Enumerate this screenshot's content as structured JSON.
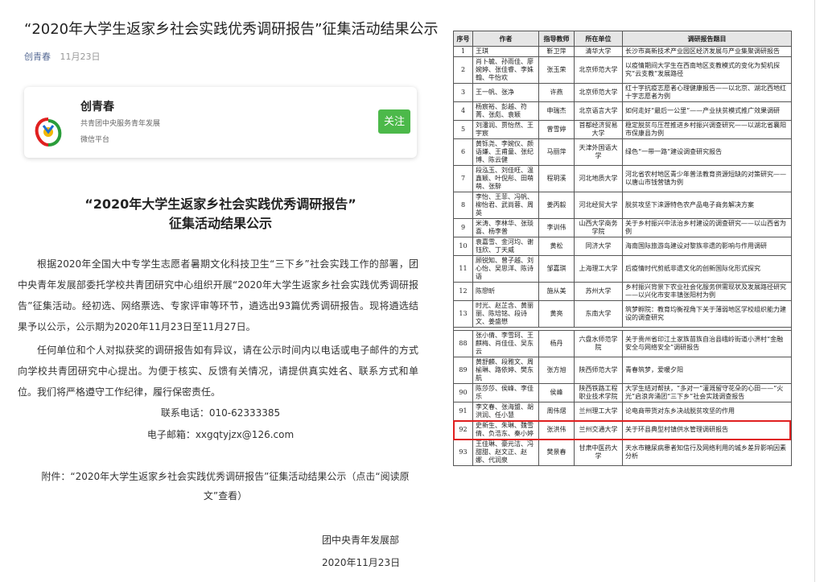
{
  "article": {
    "title": "“2020年大学生返家乡社会实践优秀调研报告”征集活动结果公示",
    "author": "创青春",
    "date": "11月23日"
  },
  "account_card": {
    "name": "创青春",
    "org": "共青团中央服务青年发展",
    "type": "微信平台",
    "follow_label": "关注",
    "follow_color": "#4cb94a"
  },
  "body": {
    "heading_line1": "“2020年大学生返家乡社会实践优秀调研报告”",
    "heading_line2": "征集活动结果公示",
    "para1": "根据2020年全国大中专学生志愿者暑期文化科技卫生“三下乡”社会实践工作的部署，团中央青年发展部委托学校共青团研究中心组织开展“2020年大学生返家乡社会实践优秀调研报告”征集活动。经初选、网络票选、专家评审等环节，遴选出93篇优秀调研报告。现将遴选结果予以公示，公示期为2020年11月23日至11月27日。",
    "para2": "任何单位和个人对拟获奖的调研报告如有异议，请在公示时间内以电话或电子邮件的方式向学校共青团研究中心提出。为便于核实、反馈有关情况，请提供真实姓名、联系方式和单位。我们将严格遵守工作纪律，履行保密责任。",
    "phone": "联系电话：010-62333385",
    "email": "电子邮箱：xxgqtyjzx@126.com",
    "attachment": "附件：“2020年大学生返家乡社会实践优秀调研报告”征集活动结果公示（点击“阅读原文”查看）",
    "signature": "团中央青年发展部",
    "sign_date": "2020年11月23日"
  },
  "table": {
    "headers": [
      "序号",
      "作者",
      "指导教师",
      "所在单位",
      "调研报告题目"
    ],
    "rows_top": [
      [
        "1",
        "王琪",
        "靳卫萍",
        "清华大学",
        "长沙市高新技术产业园区经济发展与产业集聚调研报告"
      ],
      [
        "2",
        "肖卜毓、孙雨佳、廖婉婷、张佳睿、李姝翰、牛怡欢",
        "张玉荣",
        "北京师范大学",
        "以疫情期间大学生在西南地区支教模式的变化为契机探究“云支教”发展路径"
      ],
      [
        "3",
        "王一帆、张净",
        "许燕",
        "北京师范大学",
        "红十字抗疫志愿者心理健康报告——以北京、湖北西地红十字志愿者为例"
      ],
      [
        "4",
        "杨宸裕、彭越、符菁、张彪、袁颖",
        "申瑞杰",
        "北京语言大学",
        "如何走好“最后一公里”——产业扶贫模式推广效果调研"
      ],
      [
        "5",
        "刘潘润、贾怡然、王宇宸",
        "曾雪婷",
        "首都经济贸易大学",
        "稳定脱贫与压茬推进乡村振兴调查研究——以湖北省襄阳市保康县为例"
      ],
      [
        "6",
        "黄铄尧、李婉仪、颜语嫌、王甫童、张纪博、陈云健",
        "马丽萍",
        "天津外国语大学",
        "绿色“一带一路”建设调查研究报告"
      ],
      [
        "7",
        "段泓玉、刘佳旺、温鑫颖、叶倪彤、田萌萌、张騂",
        "程玥溪",
        "河北地质大学",
        "河北省农村地区青少年普法教育资源短缺的对策研究——以唐山市钱营镇为例"
      ],
      [
        "8",
        "李怡、王菲、冯帆、柳怡君、武尚蓉、周英",
        "姜丙毅",
        "河北经贸大学",
        "脱贫攻坚下涞源特色农产品电子商务解决方案"
      ],
      [
        "9",
        "米涛、李林华、张琰喜、杨李普",
        "李训伟",
        "山西大学商务学院",
        "关于乡村振兴中法治乡村建设的调查研究——以山西省为例"
      ],
      [
        "10",
        "袁嘉雪、金河均、谢钰欣、丁天威",
        "黄松",
        "同济大学",
        "海南国际旅游岛建设对黎族非遗的影响与作用调研"
      ],
      [
        "11",
        "顾锐知、曾子越、刘心怡、吴思洋、陈诗语",
        "邹嘉琪",
        "上海理工大学",
        "后疫情时代剪纸非遗文化的创新国际化形式探究"
      ],
      [
        "12",
        "陈戀昕",
        "施从美",
        "苏州大学",
        "乡村振兴背景下农业社会化服务供需现状及发展路径研究——以兴化市安丰镇张阳村为例"
      ],
      [
        "13",
        "时光、赵芷含、黄丽丽、陈培铭、段诗文、姜盛懋",
        "黄亮",
        "东南大学",
        "筑梦孵院：教育均衡视角下关于薄弱地区学校组织能力建设的调查研究"
      ]
    ],
    "rows_bottom": [
      [
        "88",
        "张小倩、李雪珂、王麒梅、肖佳佳、吴东云",
        "杨丹",
        "六盘水师范学院",
        "关于贵州省印江土家族苗族自治县峨岭街道小淠村“金融安全与网络安全”调研报告"
      ],
      [
        "89",
        "黄舒麟、段雅文、周榆琳、路依婷、樊东航",
        "张方旭",
        "陕西师范大学",
        "青春筑梦，爱暖夕阳"
      ],
      [
        "90",
        "陈莎莎、侯峰、李佳乐",
        "侯峰",
        "陕西铁路工程职业技术学院",
        "大学生结对帮扶，“多对一”灌溉留守花朵的心田——“火光”启浪奔涌团“三下乡”社会实践调查报告"
      ],
      [
        "91",
        "李文春、张海盟、胡洪润、任小慧",
        "周伟熠",
        "兰州理工大学",
        "论电商带货对东乡决战脱贫攻坚的作用"
      ],
      [
        "92",
        "史新生、朱琳、魏雪倩、负浩东、秦小婷",
        "张洪伟",
        "兰州交通大学",
        "关于环县典型村镇供水管理调研报告"
      ],
      [
        "93",
        "王佳琳、豪元洁、冯甜甜、赵文正、赵娜、代润泉",
        "樊景春",
        "甘肃中医药大学",
        "天水市糖尿病患者知信行及网络利用的城乡差异影响因素分析"
      ]
    ],
    "highlight_row": "92",
    "highlight_color": "#e02020"
  }
}
